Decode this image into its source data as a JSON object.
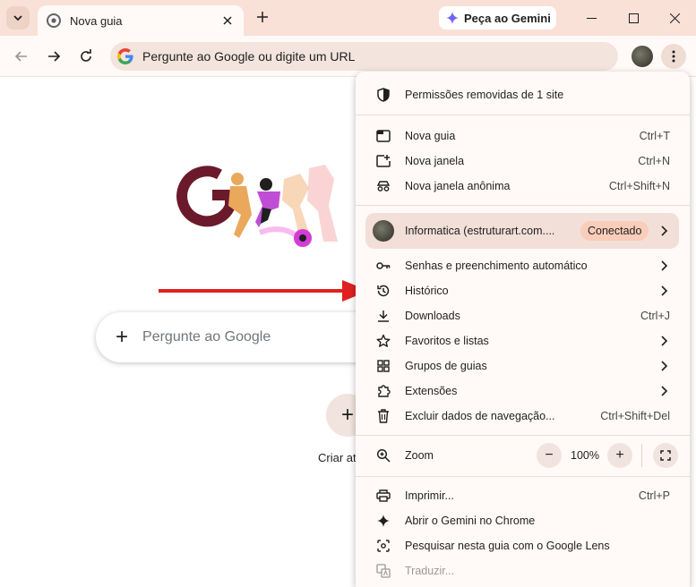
{
  "tab": {
    "title": "Nova guia"
  },
  "gemini": {
    "label": "Peça ao Gemini"
  },
  "omnibox": {
    "placeholder": "Pergunte ao Google ou digite um URL"
  },
  "page": {
    "search_placeholder": "Pergunte ao Google",
    "search_plus": "+",
    "shortcut_plus": "+",
    "shortcut_label": "Criar atalho"
  },
  "menu": {
    "permissions": "Permissões removidas de 1 site",
    "new_tab": {
      "label": "Nova guia",
      "shortcut": "Ctrl+T"
    },
    "new_window": {
      "label": "Nova janela",
      "shortcut": "Ctrl+N"
    },
    "incognito": {
      "label": "Nova janela anônima",
      "shortcut": "Ctrl+Shift+N"
    },
    "profile": {
      "name": "Informatica (estruturart.com....",
      "status": "Conectado"
    },
    "passwords": "Senhas e preenchimento automático",
    "history": "Histórico",
    "downloads": {
      "label": "Downloads",
      "shortcut": "Ctrl+J"
    },
    "bookmarks": "Favoritos e listas",
    "tab_groups": "Grupos de guias",
    "extensions": "Extensões",
    "clear_data": {
      "label": "Excluir dados de navegação...",
      "shortcut": "Ctrl+Shift+Del"
    },
    "zoom": {
      "label": "Zoom",
      "value": "100%",
      "minus": "−",
      "plus": "+"
    },
    "print": {
      "label": "Imprimir...",
      "shortcut": "Ctrl+P"
    },
    "gemini_chrome": "Abrir o Gemini no Chrome",
    "lens": "Pesquisar nesta guia com o Google Lens",
    "translate": "Traduzir..."
  },
  "colors": {
    "frame": "#f9e1d7",
    "toolbar": "#fffaf7",
    "arrow": "#e02020",
    "badge": "#f9cdb9"
  }
}
